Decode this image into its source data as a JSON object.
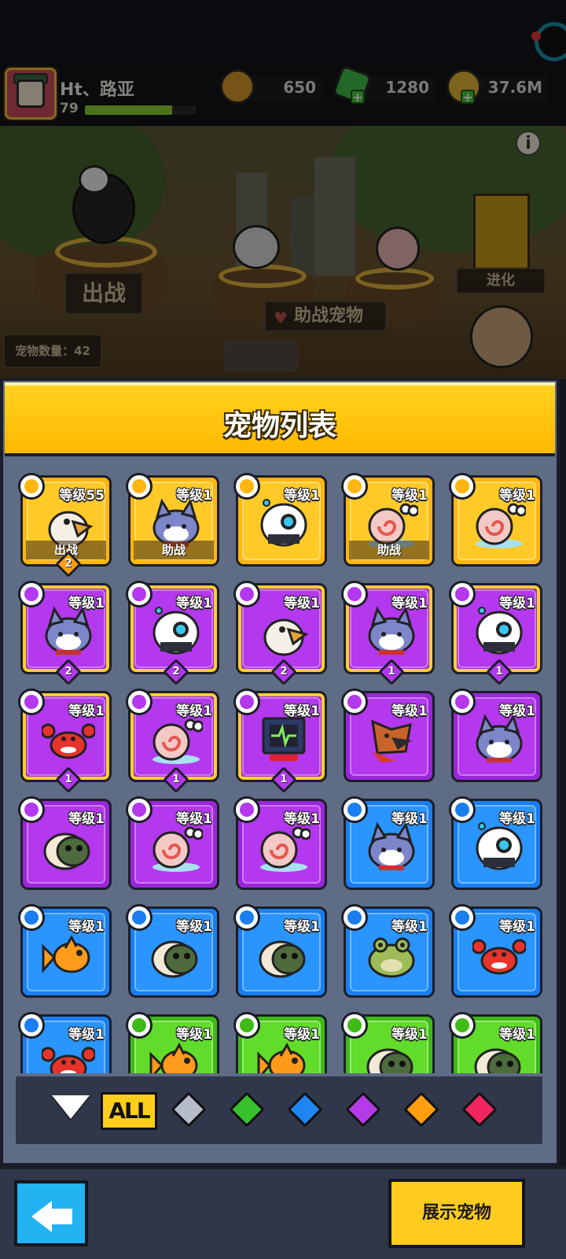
{
  "player": {
    "name": "Ht、路亚",
    "level": "79",
    "xp_progress": 0.78
  },
  "resources": [
    {
      "name": "coin",
      "value": "650"
    },
    {
      "name": "gem",
      "value": "1280"
    },
    {
      "name": "gold",
      "value": "37.6M"
    }
  ],
  "scene": {
    "battle_label": "出战",
    "assist_label": "助战宠物",
    "evolve_label": "进化",
    "pet_count": "宠物数量：42",
    "info_symbol": "i"
  },
  "panel": {
    "title": "宠物列表"
  },
  "pets": [
    {
      "rarity": "orange",
      "level": "等级55",
      "pet": "eagle",
      "status": "出战",
      "stars": "2",
      "type": "sword"
    },
    {
      "rarity": "orange",
      "level": "等级1",
      "pet": "cat",
      "status": "助战",
      "stars": "",
      "type": "coin"
    },
    {
      "rarity": "orange",
      "level": "等级1",
      "pet": "robot",
      "status": "",
      "stars": "",
      "type": "sword"
    },
    {
      "rarity": "orange",
      "level": "等级1",
      "pet": "snail",
      "status": "助战",
      "stars": "",
      "type": "shell"
    },
    {
      "rarity": "orange",
      "level": "等级1",
      "pet": "snail",
      "status": "",
      "stars": "",
      "type": "shell"
    },
    {
      "rarity": "purple",
      "level": "等级1",
      "pet": "cat",
      "status": "",
      "stars": "2",
      "type": "coin",
      "gb": true
    },
    {
      "rarity": "purple",
      "level": "等级1",
      "pet": "robot",
      "status": "",
      "stars": "2",
      "type": "sword",
      "gb": true
    },
    {
      "rarity": "purple",
      "level": "等级1",
      "pet": "eagle",
      "status": "",
      "stars": "2",
      "type": "shirt",
      "gb": true
    },
    {
      "rarity": "purple",
      "level": "等级1",
      "pet": "cat",
      "status": "",
      "stars": "1",
      "type": "coin",
      "gb": true
    },
    {
      "rarity": "purple",
      "level": "等级1",
      "pet": "robot",
      "status": "",
      "stars": "1",
      "type": "sword",
      "gb": true
    },
    {
      "rarity": "purple",
      "level": "等级1",
      "pet": "crab",
      "status": "",
      "stars": "1",
      "type": "shirt",
      "gb": true
    },
    {
      "rarity": "purple",
      "level": "等级1",
      "pet": "snail",
      "status": "",
      "stars": "1",
      "type": "shell",
      "gb": true
    },
    {
      "rarity": "purple",
      "level": "等级1",
      "pet": "monitor",
      "status": "",
      "stars": "1",
      "type": "sword",
      "gb": true
    },
    {
      "rarity": "purple",
      "level": "等级1",
      "pet": "dog",
      "status": "",
      "stars": "",
      "type": "sword"
    },
    {
      "rarity": "purple",
      "level": "等级1",
      "pet": "cat",
      "status": "",
      "stars": "",
      "type": "coin"
    },
    {
      "rarity": "purple",
      "level": "等级1",
      "pet": "turtle",
      "status": "",
      "stars": "",
      "type": "shell"
    },
    {
      "rarity": "purple",
      "level": "等级1",
      "pet": "snail",
      "status": "",
      "stars": "",
      "type": "shell"
    },
    {
      "rarity": "purple",
      "level": "等级1",
      "pet": "snail",
      "status": "",
      "stars": "",
      "type": "shell"
    },
    {
      "rarity": "blue",
      "level": "等级1",
      "pet": "cat",
      "status": "",
      "stars": "",
      "type": "coin"
    },
    {
      "rarity": "blue",
      "level": "等级1",
      "pet": "robot",
      "status": "",
      "stars": "",
      "type": "sword"
    },
    {
      "rarity": "blue",
      "level": "等级1",
      "pet": "fish",
      "status": "",
      "stars": "",
      "type": "shell"
    },
    {
      "rarity": "blue",
      "level": "等级1",
      "pet": "turtle",
      "status": "",
      "stars": "",
      "type": "shell"
    },
    {
      "rarity": "blue",
      "level": "等级1",
      "pet": "turtle",
      "status": "",
      "stars": "",
      "type": "shell"
    },
    {
      "rarity": "blue",
      "level": "等级1",
      "pet": "frog",
      "status": "",
      "stars": "",
      "type": "coin"
    },
    {
      "rarity": "blue",
      "level": "等级1",
      "pet": "crab",
      "status": "",
      "stars": "",
      "type": "shirt"
    },
    {
      "rarity": "blue",
      "level": "等级1",
      "pet": "crab",
      "status": "",
      "stars": "",
      "type": "shirt"
    },
    {
      "rarity": "green",
      "level": "等级1",
      "pet": "fish",
      "status": "",
      "stars": "",
      "type": "shell"
    },
    {
      "rarity": "green",
      "level": "等级1",
      "pet": "fish",
      "status": "",
      "stars": "",
      "type": "shell"
    },
    {
      "rarity": "green",
      "level": "等级1",
      "pet": "turtle",
      "status": "",
      "stars": "",
      "type": "shell"
    },
    {
      "rarity": "green",
      "level": "等级1",
      "pet": "turtle",
      "status": "",
      "stars": "",
      "type": "shell"
    }
  ],
  "filters": {
    "all_label": "ALL",
    "gems": [
      "#b7bccb",
      "#37c22d",
      "#1e86f0",
      "#b53ae8",
      "#ff9f0f",
      "#f0245e"
    ]
  },
  "buttons": {
    "show": "展示宠物"
  }
}
